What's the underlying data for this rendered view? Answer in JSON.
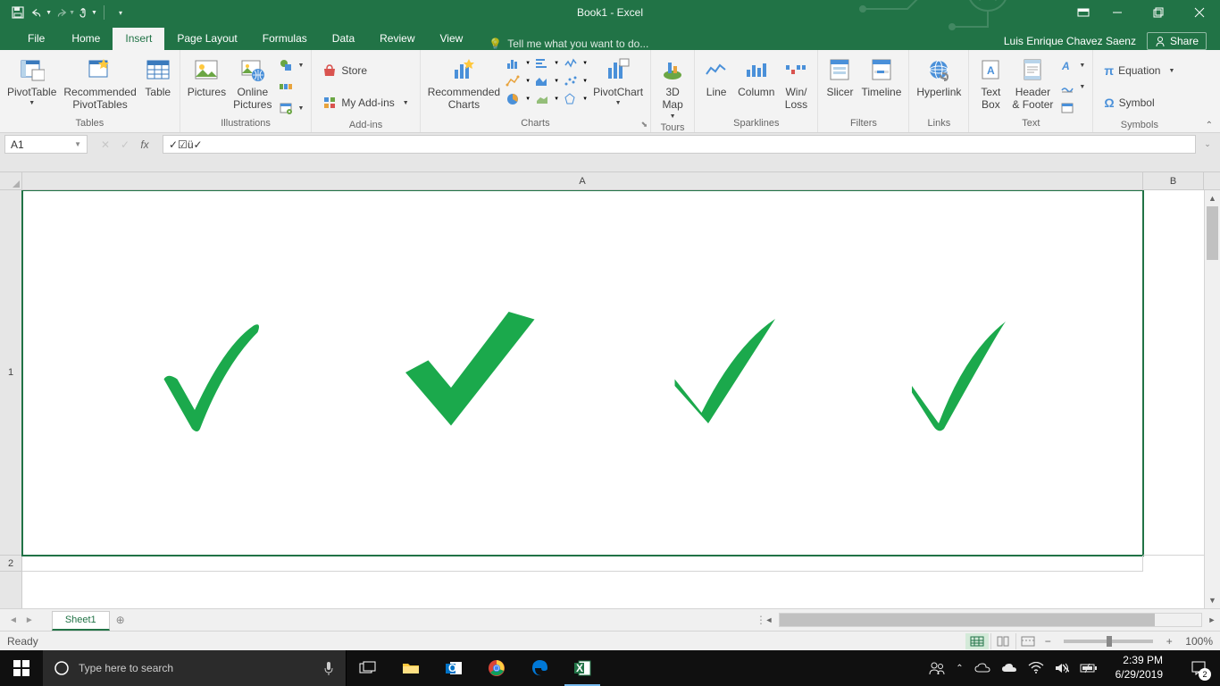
{
  "title": "Book1 - Excel",
  "qat": {
    "save": "Save",
    "undo": "Undo",
    "redo": "Redo",
    "touch": "Touch"
  },
  "tabs": {
    "file": "File",
    "home": "Home",
    "insert": "Insert",
    "page_layout": "Page Layout",
    "formulas": "Formulas",
    "data": "Data",
    "review": "Review",
    "view": "View"
  },
  "tellme": "Tell me what you want to do...",
  "user": "Luis Enrique Chavez Saenz",
  "share": "Share",
  "ribbon": {
    "tables": {
      "label": "Tables",
      "pivot": "PivotTable",
      "recpivot": "Recommended\nPivotTables",
      "table": "Table"
    },
    "illustrations": {
      "label": "Illustrations",
      "pictures": "Pictures",
      "online": "Online\nPictures"
    },
    "addins": {
      "label": "Add-ins",
      "store": "Store",
      "myaddins": "My Add-ins"
    },
    "charts": {
      "label": "Charts",
      "rec": "Recommended\nCharts",
      "pivotchart": "PivotChart"
    },
    "tours": {
      "label": "Tours",
      "map": "3D\nMap"
    },
    "sparklines": {
      "label": "Sparklines",
      "line": "Line",
      "column": "Column",
      "winloss": "Win/\nLoss"
    },
    "filters": {
      "label": "Filters",
      "slicer": "Slicer",
      "timeline": "Timeline"
    },
    "links": {
      "label": "Links",
      "hyperlink": "Hyperlink"
    },
    "text": {
      "label": "Text",
      "textbox": "Text\nBox",
      "header": "Header\n& Footer"
    },
    "symbols": {
      "label": "Symbols",
      "equation": "Equation",
      "symbol": "Symbol"
    }
  },
  "namebox": "A1",
  "formula": "✓☑ü✓",
  "columns": {
    "A": "A",
    "B": "B"
  },
  "rows": {
    "r1": "1",
    "r2": "2"
  },
  "cell_content": {
    "c1": "✓",
    "c2": "✓",
    "c3": "✓",
    "c4": "✓"
  },
  "sheet": "Sheet1",
  "status": "Ready",
  "zoom": "100%",
  "search_placeholder": "Type here to search",
  "clock": {
    "time": "2:39 PM",
    "date": "6/29/2019"
  },
  "notif_count": "2"
}
